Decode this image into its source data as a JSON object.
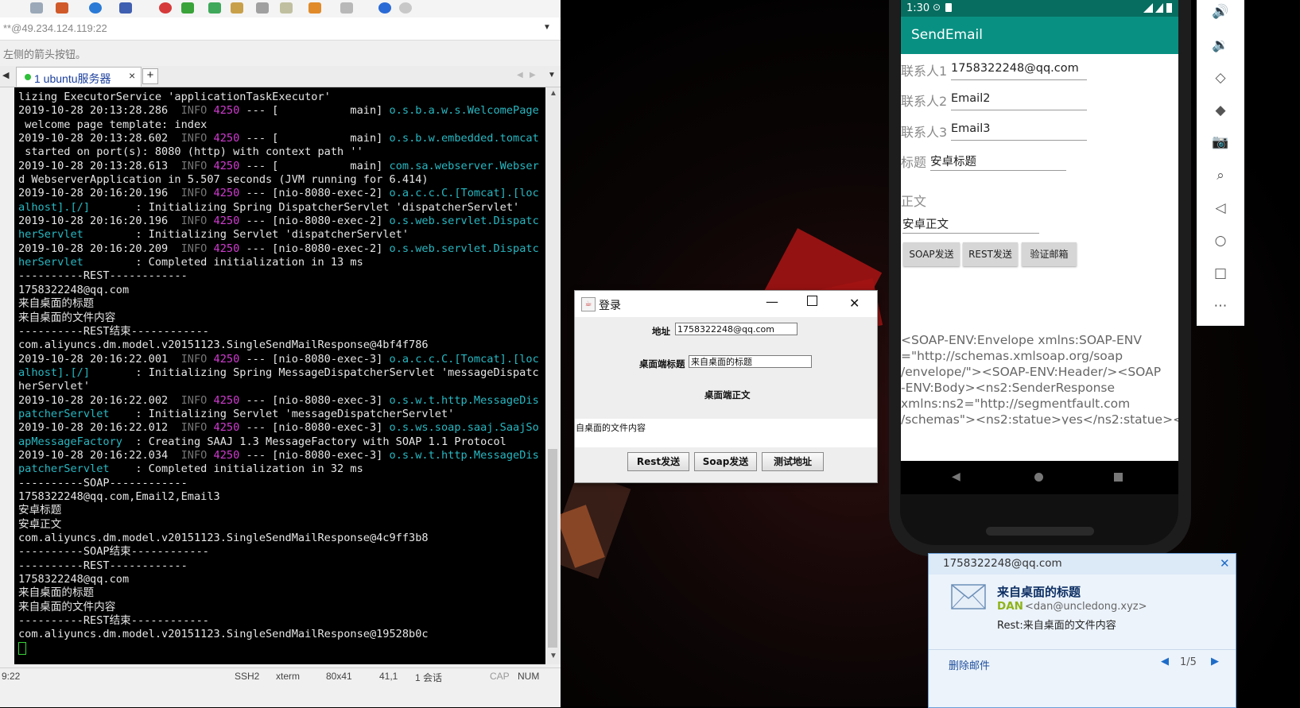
{
  "xshell": {
    "address": "**@49.234.124.119:22",
    "hint": "左侧的箭头按钮。",
    "tab_label": "1 ubuntu服务器",
    "tab_close": "×",
    "tab_add": "+",
    "status": {
      "time": "9:22",
      "protocol": "SSH2",
      "term": "xterm",
      "size": "80x41",
      "pos": "41,1",
      "sessions": "1 会话",
      "cap": "CAP",
      "num": "NUM"
    },
    "terminal_lines": [
      [
        {
          "t": "lizing ExecutorService 'applicationTaskExecutor'",
          "c": ""
        }
      ],
      [
        {
          "t": "2019-10-28 20:13:28.286 ",
          "c": ""
        },
        {
          "t": " INFO",
          "c": "gray"
        },
        {
          "t": " 4250",
          "c": "mag"
        },
        {
          "t": " --- [           main] ",
          "c": ""
        },
        {
          "t": "o.s.b.a.w.s.WelcomePage",
          "c": "cyan"
        }
      ],
      [
        {
          "t": " welcome page template: index",
          "c": ""
        }
      ],
      [
        {
          "t": "2019-10-28 20:13:28.602 ",
          "c": ""
        },
        {
          "t": " INFO",
          "c": "gray"
        },
        {
          "t": " 4250",
          "c": "mag"
        },
        {
          "t": " --- [           main] ",
          "c": ""
        },
        {
          "t": "o.s.b.w.embedded.tomcat",
          "c": "cyan"
        }
      ],
      [
        {
          "t": " started on port(s): 8080 (http) with context path ''",
          "c": ""
        }
      ],
      [
        {
          "t": "2019-10-28 20:13:28.613 ",
          "c": ""
        },
        {
          "t": " INFO",
          "c": "gray"
        },
        {
          "t": " 4250",
          "c": "mag"
        },
        {
          "t": " --- [           main] ",
          "c": ""
        },
        {
          "t": "com.sa.webserver.Webser",
          "c": "cyan"
        }
      ],
      [
        {
          "t": "d WebserverApplication in 5.507 seconds (JVM running for 6.414)",
          "c": ""
        }
      ],
      [
        {
          "t": "2019-10-28 20:16:20.196 ",
          "c": ""
        },
        {
          "t": " INFO",
          "c": "gray"
        },
        {
          "t": " 4250",
          "c": "mag"
        },
        {
          "t": " --- [nio-8080-exec-2] ",
          "c": ""
        },
        {
          "t": "o.a.c.c.C.[Tomcat].[loc",
          "c": "cyan"
        }
      ],
      [
        {
          "t": "alhost].[/]",
          "c": "cyan"
        },
        {
          "t": "       : Initializing Spring DispatcherServlet 'dispatcherServlet'",
          "c": ""
        }
      ],
      [
        {
          "t": "2019-10-28 20:16:20.196 ",
          "c": ""
        },
        {
          "t": " INFO",
          "c": "gray"
        },
        {
          "t": " 4250",
          "c": "mag"
        },
        {
          "t": " --- [nio-8080-exec-2] ",
          "c": ""
        },
        {
          "t": "o.s.web.servlet.Dispatc",
          "c": "cyan"
        }
      ],
      [
        {
          "t": "herServlet",
          "c": "cyan"
        },
        {
          "t": "        : Initializing Servlet 'dispatcherServlet'",
          "c": ""
        }
      ],
      [
        {
          "t": "2019-10-28 20:16:20.209 ",
          "c": ""
        },
        {
          "t": " INFO",
          "c": "gray"
        },
        {
          "t": " 4250",
          "c": "mag"
        },
        {
          "t": " --- [nio-8080-exec-2] ",
          "c": ""
        },
        {
          "t": "o.s.web.servlet.Dispatc",
          "c": "cyan"
        }
      ],
      [
        {
          "t": "herServlet",
          "c": "cyan"
        },
        {
          "t": "        : Completed initialization in 13 ms",
          "c": ""
        }
      ],
      [
        {
          "t": "----------REST------------",
          "c": ""
        }
      ],
      [
        {
          "t": "1758322248@qq.com",
          "c": ""
        }
      ],
      [
        {
          "t": "来自桌面的标题",
          "c": ""
        }
      ],
      [
        {
          "t": "来自桌面的文件内容",
          "c": ""
        }
      ],
      [
        {
          "t": "----------REST结束------------",
          "c": ""
        }
      ],
      [
        {
          "t": "com.aliyuncs.dm.model.v20151123.SingleSendMailResponse@4bf4f786",
          "c": ""
        }
      ],
      [
        {
          "t": "2019-10-28 20:16:22.001 ",
          "c": ""
        },
        {
          "t": " INFO",
          "c": "gray"
        },
        {
          "t": " 4250",
          "c": "mag"
        },
        {
          "t": " --- [nio-8080-exec-3] ",
          "c": ""
        },
        {
          "t": "o.a.c.c.C.[Tomcat].[loc",
          "c": "cyan"
        }
      ],
      [
        {
          "t": "alhost].[/]",
          "c": "cyan"
        },
        {
          "t": "       : Initializing Spring MessageDispatcherServlet 'messageDispatc",
          "c": ""
        }
      ],
      [
        {
          "t": "herServlet'",
          "c": ""
        }
      ],
      [
        {
          "t": "2019-10-28 20:16:22.002 ",
          "c": ""
        },
        {
          "t": " INFO",
          "c": "gray"
        },
        {
          "t": " 4250",
          "c": "mag"
        },
        {
          "t": " --- [nio-8080-exec-3] ",
          "c": ""
        },
        {
          "t": "o.s.w.t.http.MessageDis",
          "c": "cyan"
        }
      ],
      [
        {
          "t": "patcherServlet",
          "c": "cyan"
        },
        {
          "t": "    : Initializing Servlet 'messageDispatcherServlet'",
          "c": ""
        }
      ],
      [
        {
          "t": "2019-10-28 20:16:22.012 ",
          "c": ""
        },
        {
          "t": " INFO",
          "c": "gray"
        },
        {
          "t": " 4250",
          "c": "mag"
        },
        {
          "t": " --- [nio-8080-exec-3] ",
          "c": ""
        },
        {
          "t": "o.s.ws.soap.saaj.SaajSo",
          "c": "cyan"
        }
      ],
      [
        {
          "t": "apMessageFactory",
          "c": "cyan"
        },
        {
          "t": "  : Creating SAAJ 1.3 MessageFactory with SOAP 1.1 Protocol",
          "c": ""
        }
      ],
      [
        {
          "t": "2019-10-28 20:16:22.034 ",
          "c": ""
        },
        {
          "t": " INFO",
          "c": "gray"
        },
        {
          "t": " 4250",
          "c": "mag"
        },
        {
          "t": " --- [nio-8080-exec-3] ",
          "c": ""
        },
        {
          "t": "o.s.w.t.http.MessageDis",
          "c": "cyan"
        }
      ],
      [
        {
          "t": "patcherServlet",
          "c": "cyan"
        },
        {
          "t": "    : Completed initialization in 32 ms",
          "c": ""
        }
      ],
      [
        {
          "t": "----------SOAP------------",
          "c": ""
        }
      ],
      [
        {
          "t": "1758322248@qq.com,Email2,Email3",
          "c": ""
        }
      ],
      [
        {
          "t": "安卓标题",
          "c": ""
        }
      ],
      [
        {
          "t": "安卓正文",
          "c": ""
        }
      ],
      [
        {
          "t": "com.aliyuncs.dm.model.v20151123.SingleSendMailResponse@4c9ff3b8",
          "c": ""
        }
      ],
      [
        {
          "t": "----------SOAP结束------------",
          "c": ""
        }
      ],
      [
        {
          "t": "----------REST------------",
          "c": ""
        }
      ],
      [
        {
          "t": "1758322248@qq.com",
          "c": ""
        }
      ],
      [
        {
          "t": "来自桌面的标题",
          "c": ""
        }
      ],
      [
        {
          "t": "来自桌面的文件内容",
          "c": ""
        }
      ],
      [
        {
          "t": "----------REST结束------------",
          "c": ""
        }
      ],
      [
        {
          "t": "com.aliyuncs.dm.model.v20151123.SingleSendMailResponse@19528b0c",
          "c": ""
        }
      ]
    ]
  },
  "login": {
    "title": "登录",
    "address_label": "地址",
    "address_value": "1758322248@qq.com",
    "subject_label": "桌面端标题",
    "subject_value": "来自桌面的标题",
    "body_label": "桌面端正文",
    "body_value": "自桌面的文件内容",
    "btn_rest": "Rest发送",
    "btn_soap": "Soap发送",
    "btn_test": "测试地址",
    "minimize": "—",
    "close": "✕"
  },
  "android": {
    "time": "1:30",
    "app_title": "SendEmail",
    "contact1_label": "联系人1",
    "contact1_value": "1758322248@qq.com",
    "contact2_label": "联系人2",
    "contact2_value": "Email2",
    "contact3_label": "联系人3",
    "contact3_value": "Email3",
    "subject_label": "标题",
    "subject_value": "安卓标题",
    "body_label": "正文",
    "body_value": "安卓正文",
    "btn_soap": "SOAP发送",
    "btn_rest": "REST发送",
    "btn_verify": "验证邮箱",
    "soap_response": "<SOAP-ENV:Envelope xmlns:SOAP-ENV\n=\"http://schemas.xmlsoap.org/soap\n/envelope/\"><SOAP-ENV:Header/><SOAP\n-ENV:Body><ns2:SenderResponse\nxmlns:ns2=\"http://segmentfault.com\n/schemas\"><ns2:statue>yes</ns2:statue><"
  },
  "notification": {
    "from": "1758322248@qq.com",
    "subject": "来自桌面的标题",
    "sender_name": "DAN",
    "sender_addr": "<dan@uncledong.xyz>",
    "preview": "Rest:来自桌面的文件内容",
    "delete": "删除邮件",
    "page": "1/5"
  },
  "colors": {
    "android_primary": "#089183",
    "android_primary_dark": "#066d60",
    "terminal_bg": "#000000",
    "log_level": "#767676",
    "log_pid": "#d23cd2",
    "log_class": "#27b8c2"
  }
}
